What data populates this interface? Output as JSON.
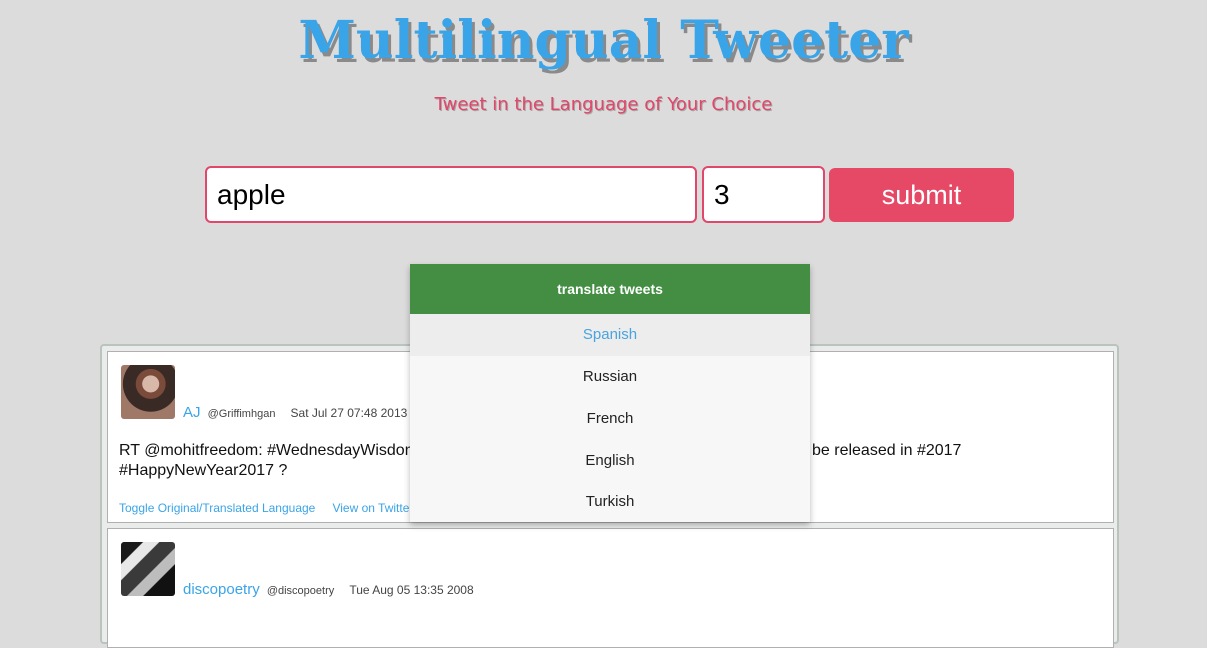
{
  "header": {
    "title": "Multilingual Tweeter",
    "subtitle": "Tweet in the Language of Your Choice"
  },
  "search": {
    "query_value": "apple",
    "count_value": "3",
    "submit_label": "submit"
  },
  "translate_menu": {
    "header": "translate tweets",
    "selected": "Spanish",
    "options": [
      "Spanish",
      "Russian",
      "French",
      "English",
      "Turkish"
    ]
  },
  "tweets": [
    {
      "name": "AJ",
      "handle": "@Griffimhgan",
      "date": "Sat Jul 27 07:48 2013",
      "text_line1": "RT @mohitfreedom: #WednesdayWisdom",
      "text_line1_end": "be released in #2017",
      "text_line2": "#HappyNewYear2017 ?",
      "links": [
        "Toggle Original/Translated Language",
        "View on Twitter"
      ]
    },
    {
      "name": "discopoetry",
      "handle": "@discopoetry",
      "date": "Tue Aug 05 13:35 2008"
    }
  ],
  "colors": {
    "accent_blue": "#3aa4e8",
    "accent_pink": "#e64966",
    "menu_green": "#438e43",
    "background": "#dcdcdc"
  }
}
